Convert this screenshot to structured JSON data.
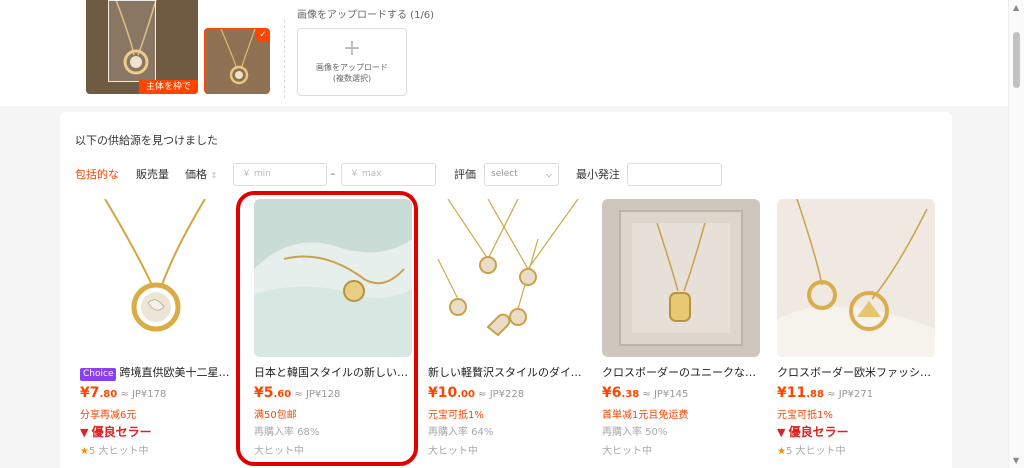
{
  "upload": {
    "crop_label": "主体を枠で",
    "title": "画像をアップロードする (1/6)",
    "box_line1": "画像をアップロード",
    "box_line2": "(複数選択)",
    "check": "✓"
  },
  "results": {
    "title": "以下の供給源を見つけました"
  },
  "filters": {
    "comprehensive": "包括的な",
    "sales": "販売量",
    "price": "価格",
    "price_min_placeholder": "￥ min",
    "dash": "–",
    "price_max_placeholder": "￥ max",
    "rating": "評価",
    "rating_select": "select",
    "moq": "最小発注"
  },
  "colors": {
    "accent": "#ff4400",
    "highlight": "#e00000",
    "choice_badge": "#8a3ff0"
  },
  "products": [
    {
      "badge": "Choice",
      "title": "跨境直供欧美十二星座圆牌项链",
      "price_yen": "¥7",
      "price_cents": ".80",
      "jp": "≈ JP¥178",
      "promo": "分享再减6元",
      "seller": "優良セラー",
      "line5": "5 大ヒット中",
      "star": "★"
    },
    {
      "title": "日本と韓国スタイルの新しいネックレス",
      "price_yen": "¥5",
      "price_cents": ".60",
      "jp": "≈ JP¥128",
      "promo": "满50包邮",
      "line4": "再購入率 68%",
      "line5": "大ヒット中"
    },
    {
      "title": "新しい軽贅沢スタイルのダイヤモンドネックレス",
      "price_yen": "¥10",
      "price_cents": ".00",
      "jp": "≈ JP¥228",
      "promo": "元宝可抵1%",
      "line4": "再購入率 64%",
      "line5": "大ヒット中"
    },
    {
      "title": "クロスボーダーのユニークなネックレス",
      "price_yen": "¥6",
      "price_cents": ".38",
      "jp": "≈ JP¥145",
      "promo": "首単减1元且免运费",
      "line4": "再購入率 50%",
      "line5": "大ヒット中"
    },
    {
      "title": "クロスボーダー欧米ファッションネックレス",
      "price_yen": "¥11",
      "price_cents": ".88",
      "jp": "≈ JP¥271",
      "promo": "元宝可抵1%",
      "seller": "優良セラー",
      "line5": "5 大ヒット中",
      "star": "★"
    }
  ]
}
